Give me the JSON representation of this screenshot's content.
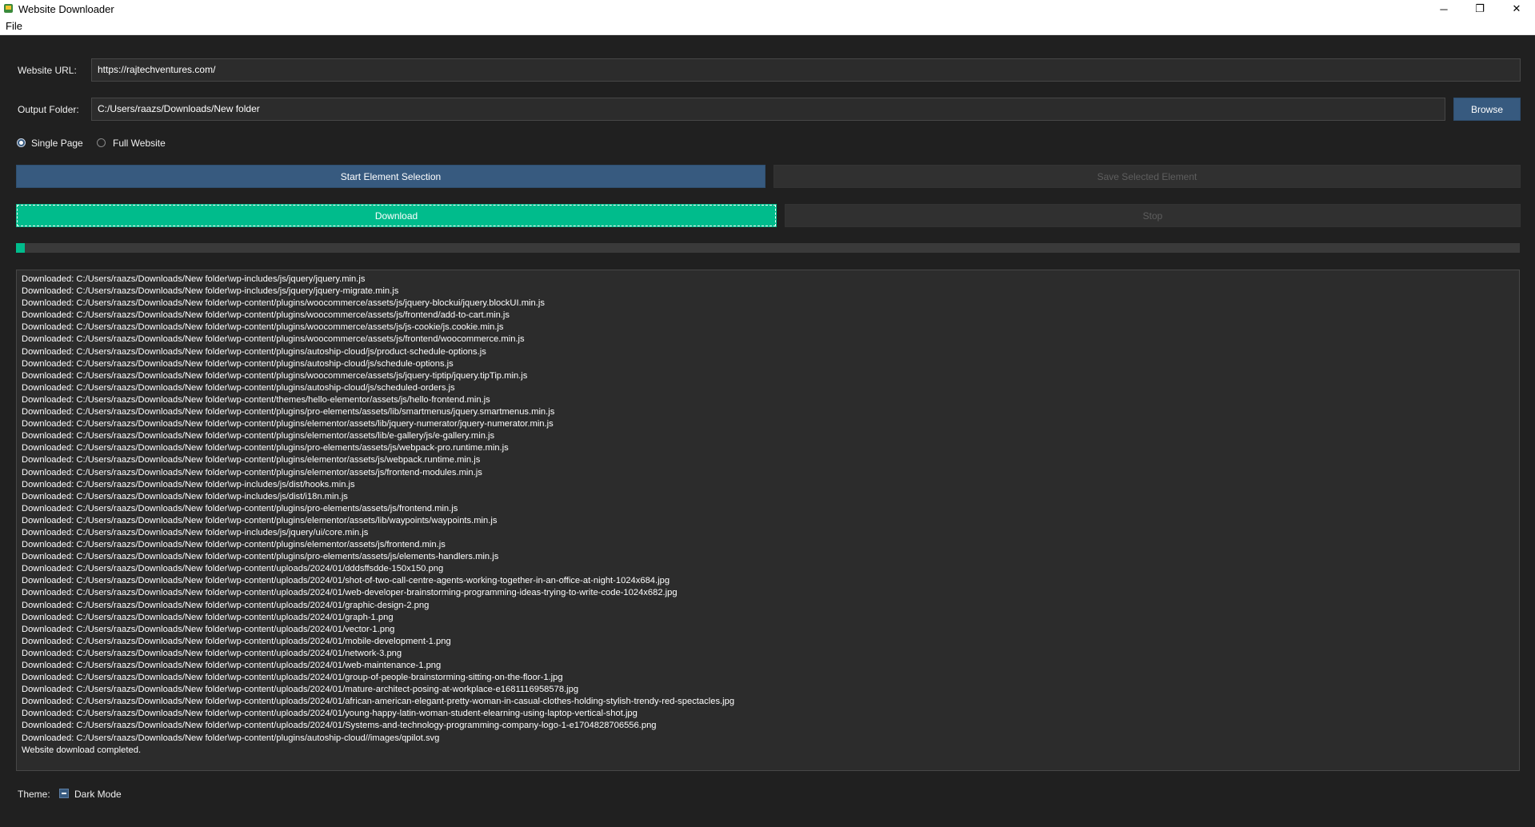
{
  "window": {
    "title": "Website Downloader",
    "minimize": "─",
    "maximize": "❐",
    "close": "✕"
  },
  "menu": {
    "file": "File"
  },
  "form": {
    "url_label": "Website URL:",
    "url_value": "https://rajtechventures.com/",
    "output_label": "Output Folder:",
    "output_value": "C:/Users/raazs/Downloads/New folder",
    "browse_label": "Browse"
  },
  "mode": {
    "single_page": "Single Page",
    "full_website": "Full Website",
    "selected": "Single Page"
  },
  "buttons": {
    "start_selection": "Start Element Selection",
    "save_selected": "Save Selected Element",
    "download": "Download",
    "stop": "Stop"
  },
  "progress": {
    "fraction": 0.006
  },
  "log": [
    "Downloaded: C:/Users/raazs/Downloads/New folder\\wp-includes/js/jquery/jquery.min.js",
    "Downloaded: C:/Users/raazs/Downloads/New folder\\wp-includes/js/jquery/jquery-migrate.min.js",
    "Downloaded: C:/Users/raazs/Downloads/New folder\\wp-content/plugins/woocommerce/assets/js/jquery-blockui/jquery.blockUI.min.js",
    "Downloaded: C:/Users/raazs/Downloads/New folder\\wp-content/plugins/woocommerce/assets/js/frontend/add-to-cart.min.js",
    "Downloaded: C:/Users/raazs/Downloads/New folder\\wp-content/plugins/woocommerce/assets/js/js-cookie/js.cookie.min.js",
    "Downloaded: C:/Users/raazs/Downloads/New folder\\wp-content/plugins/woocommerce/assets/js/frontend/woocommerce.min.js",
    "Downloaded: C:/Users/raazs/Downloads/New folder\\wp-content/plugins/autoship-cloud/js/product-schedule-options.js",
    "Downloaded: C:/Users/raazs/Downloads/New folder\\wp-content/plugins/autoship-cloud/js/schedule-options.js",
    "Downloaded: C:/Users/raazs/Downloads/New folder\\wp-content/plugins/woocommerce/assets/js/jquery-tiptip/jquery.tipTip.min.js",
    "Downloaded: C:/Users/raazs/Downloads/New folder\\wp-content/plugins/autoship-cloud/js/scheduled-orders.js",
    "Downloaded: C:/Users/raazs/Downloads/New folder\\wp-content/themes/hello-elementor/assets/js/hello-frontend.min.js",
    "Downloaded: C:/Users/raazs/Downloads/New folder\\wp-content/plugins/pro-elements/assets/lib/smartmenus/jquery.smartmenus.min.js",
    "Downloaded: C:/Users/raazs/Downloads/New folder\\wp-content/plugins/elementor/assets/lib/jquery-numerator/jquery-numerator.min.js",
    "Downloaded: C:/Users/raazs/Downloads/New folder\\wp-content/plugins/elementor/assets/lib/e-gallery/js/e-gallery.min.js",
    "Downloaded: C:/Users/raazs/Downloads/New folder\\wp-content/plugins/pro-elements/assets/js/webpack-pro.runtime.min.js",
    "Downloaded: C:/Users/raazs/Downloads/New folder\\wp-content/plugins/elementor/assets/js/webpack.runtime.min.js",
    "Downloaded: C:/Users/raazs/Downloads/New folder\\wp-content/plugins/elementor/assets/js/frontend-modules.min.js",
    "Downloaded: C:/Users/raazs/Downloads/New folder\\wp-includes/js/dist/hooks.min.js",
    "Downloaded: C:/Users/raazs/Downloads/New folder\\wp-includes/js/dist/i18n.min.js",
    "Downloaded: C:/Users/raazs/Downloads/New folder\\wp-content/plugins/pro-elements/assets/js/frontend.min.js",
    "Downloaded: C:/Users/raazs/Downloads/New folder\\wp-content/plugins/elementor/assets/lib/waypoints/waypoints.min.js",
    "Downloaded: C:/Users/raazs/Downloads/New folder\\wp-includes/js/jquery/ui/core.min.js",
    "Downloaded: C:/Users/raazs/Downloads/New folder\\wp-content/plugins/elementor/assets/js/frontend.min.js",
    "Downloaded: C:/Users/raazs/Downloads/New folder\\wp-content/plugins/pro-elements/assets/js/elements-handlers.min.js",
    "Downloaded: C:/Users/raazs/Downloads/New folder\\wp-content/uploads/2024/01/dddsffsdde-150x150.png",
    "Downloaded: C:/Users/raazs/Downloads/New folder\\wp-content/uploads/2024/01/shot-of-two-call-centre-agents-working-together-in-an-office-at-night-1024x684.jpg",
    "Downloaded: C:/Users/raazs/Downloads/New folder\\wp-content/uploads/2024/01/web-developer-brainstorming-programming-ideas-trying-to-write-code-1024x682.jpg",
    "Downloaded: C:/Users/raazs/Downloads/New folder\\wp-content/uploads/2024/01/graphic-design-2.png",
    "Downloaded: C:/Users/raazs/Downloads/New folder\\wp-content/uploads/2024/01/graph-1.png",
    "Downloaded: C:/Users/raazs/Downloads/New folder\\wp-content/uploads/2024/01/vector-1.png",
    "Downloaded: C:/Users/raazs/Downloads/New folder\\wp-content/uploads/2024/01/mobile-development-1.png",
    "Downloaded: C:/Users/raazs/Downloads/New folder\\wp-content/uploads/2024/01/network-3.png",
    "Downloaded: C:/Users/raazs/Downloads/New folder\\wp-content/uploads/2024/01/web-maintenance-1.png",
    "Downloaded: C:/Users/raazs/Downloads/New folder\\wp-content/uploads/2024/01/group-of-people-brainstorming-sitting-on-the-floor-1.jpg",
    "Downloaded: C:/Users/raazs/Downloads/New folder\\wp-content/uploads/2024/01/mature-architect-posing-at-workplace-e1681116958578.jpg",
    "Downloaded: C:/Users/raazs/Downloads/New folder\\wp-content/uploads/2024/01/african-american-elegant-pretty-woman-in-casual-clothes-holding-stylish-trendy-red-spectacles.jpg",
    "Downloaded: C:/Users/raazs/Downloads/New folder\\wp-content/uploads/2024/01/young-happy-latin-woman-student-elearning-using-laptop-vertical-shot.jpg",
    "Downloaded: C:/Users/raazs/Downloads/New folder\\wp-content/uploads/2024/01/Systems-and-technology-programming-company-logo-1-e1704828706556.png",
    "Downloaded: C:/Users/raazs/Downloads/New folder\\wp-content/plugins/autoship-cloud//images/qpilot.svg",
    "Website download completed."
  ],
  "theme": {
    "label": "Theme:",
    "dark_mode_label": "Dark Mode",
    "dark_mode_state": "indeterminate"
  },
  "colors": {
    "background": "#202020",
    "primary": "#375a7f",
    "success": "#00bc8c",
    "field_bg": "#2c2c2c"
  }
}
